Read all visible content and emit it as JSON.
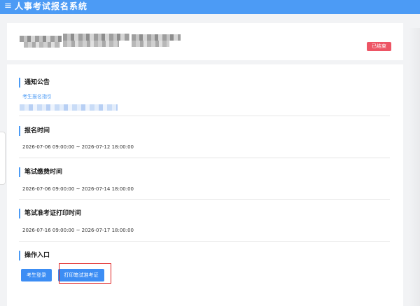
{
  "header": {
    "menu_icon": "≡",
    "title": "人事考试报名系统"
  },
  "exam_card": {
    "status_badge": "已结束"
  },
  "notice": {
    "title": "通知公告",
    "link": "考生报名指引"
  },
  "registration": {
    "title": "报名时间",
    "time": "2026-07-06 09:00:00 ~ 2026-07-12 18:00:00"
  },
  "payment": {
    "title": "笔试缴费时间",
    "time": "2026-07-06 09:00:00 ~ 2026-07-14 18:00:00"
  },
  "admission": {
    "title": "笔试准考证打印时间",
    "time": "2026-07-16 09:00:00 ~ 2026-07-17 18:00:00"
  },
  "actions": {
    "title": "操作入口",
    "login_button": "考生登录",
    "print_button": "打印笔试准考证"
  },
  "colors": {
    "primary": "#4c9bf5",
    "button": "#3c8df4",
    "badge": "#ed5565",
    "highlight": "#e02020"
  }
}
